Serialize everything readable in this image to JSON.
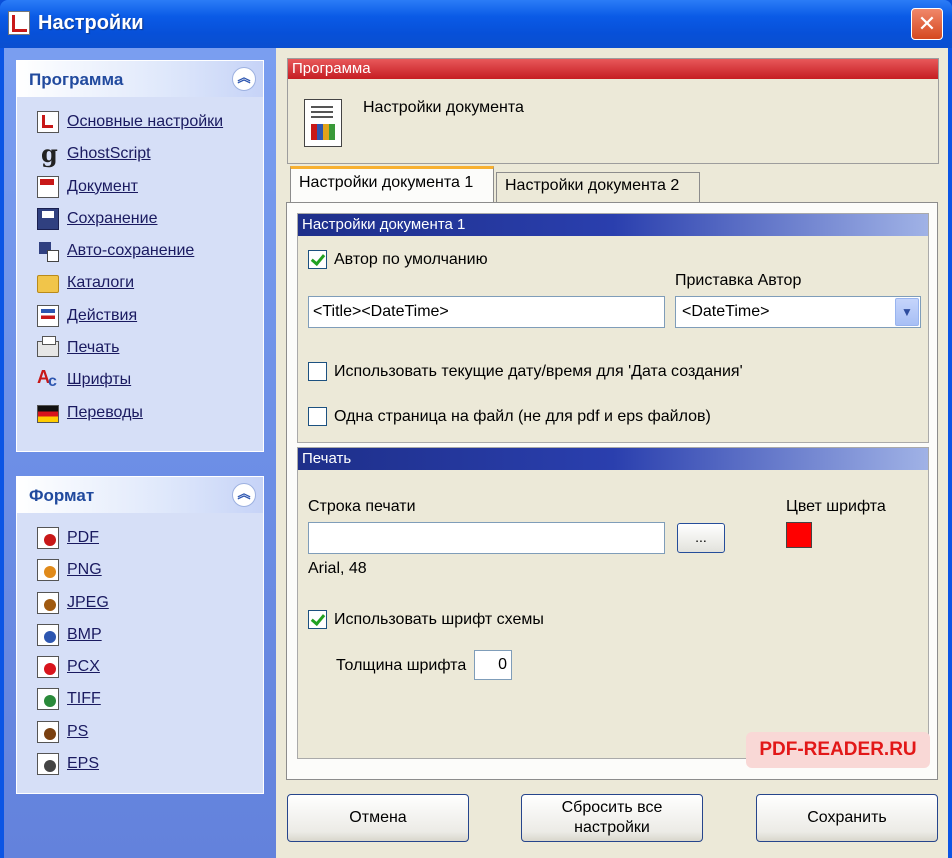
{
  "window": {
    "title": "Настройки",
    "close_glyph": "✕"
  },
  "sidebar": {
    "program_group": {
      "title": "Программа",
      "collapse_glyph": "︽",
      "items": [
        {
          "label": "Основные настройки",
          "icon": "document-settings-icon"
        },
        {
          "label": "GhostScript",
          "icon": "ghostscript-icon"
        },
        {
          "label": "Документ",
          "icon": "document-icon"
        },
        {
          "label": "Сохранение",
          "icon": "floppy-disk-icon"
        },
        {
          "label": "Авто-сохранение",
          "icon": "autosave-icon"
        },
        {
          "label": "Каталоги",
          "icon": "folder-icon"
        },
        {
          "label": "Действия",
          "icon": "actions-icon"
        },
        {
          "label": "Печать",
          "icon": "printer-icon"
        },
        {
          "label": "Шрифты",
          "icon": "fonts-icon"
        },
        {
          "label": "Переводы",
          "icon": "flag-icon"
        }
      ]
    },
    "format_group": {
      "title": "Формат",
      "collapse_glyph": "︽",
      "items": [
        {
          "label": "PDF",
          "icon": "pdf-file-icon"
        },
        {
          "label": "PNG",
          "icon": "png-file-icon"
        },
        {
          "label": "JPEG",
          "icon": "jpeg-file-icon"
        },
        {
          "label": "BMP",
          "icon": "bmp-file-icon"
        },
        {
          "label": "PCX",
          "icon": "pcx-file-icon"
        },
        {
          "label": "TIFF",
          "icon": "tiff-file-icon"
        },
        {
          "label": "PS",
          "icon": "ps-file-icon"
        },
        {
          "label": "EPS",
          "icon": "eps-file-icon"
        }
      ]
    }
  },
  "program_panel": {
    "header": "Программа",
    "description": "Настройки документа"
  },
  "tabs": [
    {
      "label": "Настройки документа 1",
      "active": true
    },
    {
      "label": "Настройки документа 2",
      "active": false
    }
  ],
  "doc_settings": {
    "header": "Настройки документа 1",
    "default_author_label": "Автор по умолчанию",
    "default_author_checked": true,
    "title_value": "<Title><DateTime>",
    "prefix_author_label": "Приставка Автор",
    "prefix_author_value": "<DateTime>",
    "use_datetime_label": "Использовать текущие дату/время для 'Дата создания'",
    "use_datetime_checked": false,
    "one_page_label": "Одна страница на файл (не для pdf и eps файлов)",
    "one_page_checked": false
  },
  "print_settings": {
    "header": "Печать",
    "print_string_label": "Строка печати",
    "print_string_value": "",
    "browse_label": "...",
    "font_info": "Arial, 48",
    "font_color_label": "Цвет шрифта",
    "font_color": "#ff0000",
    "use_scheme_font_label": "Использовать шрифт схемы",
    "use_scheme_font_checked": true,
    "font_weight_label": "Толщина шрифта",
    "font_weight_value": "0"
  },
  "watermark": "PDF-READER.RU",
  "buttons": {
    "cancel": "Отмена",
    "reset_line1": "Сбросить все",
    "reset_line2": "настройки",
    "save": "Сохранить"
  }
}
